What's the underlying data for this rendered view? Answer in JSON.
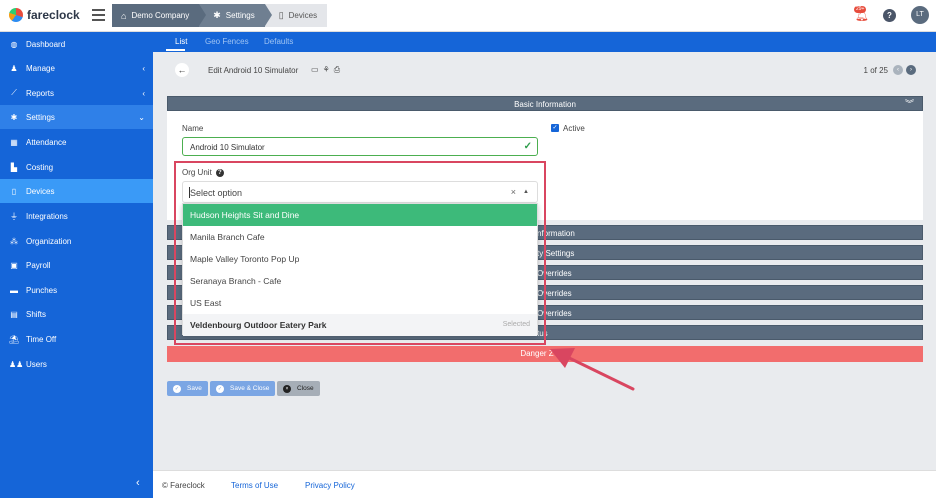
{
  "app": {
    "name": "fareclock"
  },
  "breadcrumbs": [
    "Demo Company",
    "Settings",
    "Devices"
  ],
  "header": {
    "notification_count": "29+",
    "help_label": "?",
    "avatar_initials": "LT"
  },
  "sidebar": {
    "items": [
      {
        "label": "Dashboard",
        "icon": "dashboard-icon",
        "glyph": "◍"
      },
      {
        "label": "Manage",
        "icon": "person-icon",
        "glyph": "♟",
        "chev": "‹"
      },
      {
        "label": "Reports",
        "icon": "chart-icon",
        "glyph": "⟋",
        "chev": "‹"
      },
      {
        "label": "Settings",
        "icon": "gear-icon",
        "glyph": "✱",
        "chev": "⌄"
      },
      {
        "label": "Attendance",
        "icon": "attendance-icon",
        "glyph": "▦"
      },
      {
        "label": "Costing",
        "icon": "costing-icon",
        "glyph": "▙"
      },
      {
        "label": "Devices",
        "icon": "device-icon",
        "glyph": "▯"
      },
      {
        "label": "Integrations",
        "icon": "plug-icon",
        "glyph": "⏚"
      },
      {
        "label": "Organization",
        "icon": "org-icon",
        "glyph": "⁂"
      },
      {
        "label": "Payroll",
        "icon": "payroll-icon",
        "glyph": "▣"
      },
      {
        "label": "Punches",
        "icon": "punch-icon",
        "glyph": "▬"
      },
      {
        "label": "Shifts",
        "icon": "shifts-icon",
        "glyph": "▤"
      },
      {
        "label": "Time Off",
        "icon": "timeoff-icon",
        "glyph": "⛱"
      },
      {
        "label": "Users",
        "icon": "users-icon",
        "glyph": "♟♟"
      }
    ],
    "collapse_glyph": "‹"
  },
  "tabs": [
    "List",
    "Geo Fences",
    "Defaults"
  ],
  "toolbar": {
    "record_title": "Edit Android 10 Simulator",
    "pager_text": "1 of 25"
  },
  "basic_info": {
    "title": "Basic Information"
  },
  "form": {
    "name_label": "Name",
    "name_value": "Android 10 Simulator",
    "active_label": "Active",
    "org_unit_label": "Org Unit",
    "select_placeholder": "Select option"
  },
  "dropdown": {
    "options": [
      "Hudson Heights Sit and Dine",
      "Manila Branch Cafe",
      "Maple Valley Toronto Pop Up",
      "Seranaya Branch - Cafe",
      "US East",
      "Veldenbourg Outdoor Eatery Park"
    ],
    "selected_tag": "Selected"
  },
  "sections_visible": [
    "nformation",
    "ty Settings",
    "Overrides",
    "Overrides",
    "Overrides",
    "tus"
  ],
  "danger_label": "Danger Z",
  "buttons": {
    "save": "Save",
    "save_close": "Save & Close",
    "close": "Close"
  },
  "footer": {
    "copyright": "© Fareclock",
    "terms": "Terms of Use",
    "privacy": "Privacy Policy"
  },
  "colors": {
    "sidebar": "#1565d8",
    "section": "#5a6b7e",
    "highlight": "#3dba7a",
    "danger": "#f26d6d",
    "annotation": "#d94660"
  }
}
